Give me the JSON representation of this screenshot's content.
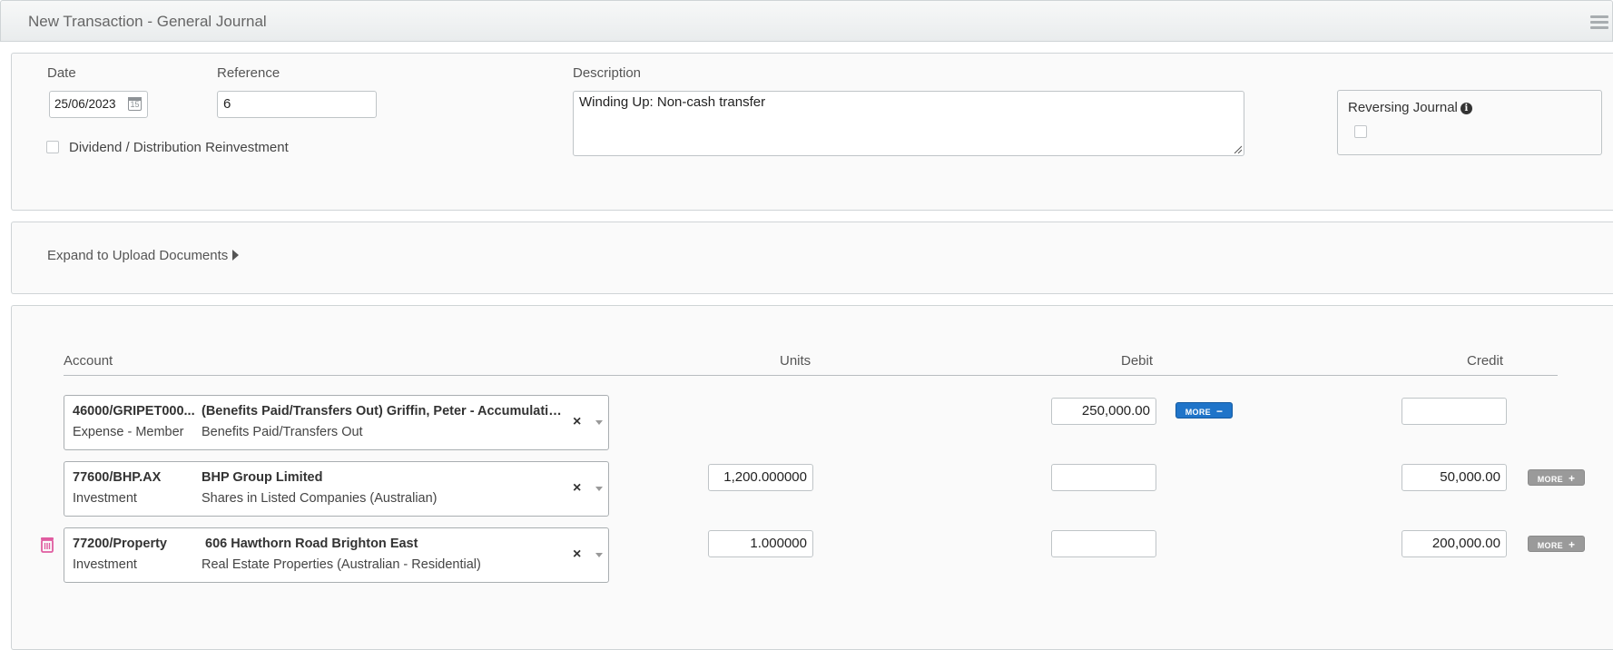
{
  "window": {
    "title": "New Transaction - General Journal"
  },
  "header_form": {
    "date_label": "Date",
    "date_value": "25/06/2023",
    "date_icon_text": "15",
    "reference_label": "Reference",
    "reference_value": "6",
    "description_label": "Description",
    "description_value": "Winding Up: Non-cash transfer",
    "dividend_label": "Dividend / Distribution Reinvestment",
    "dividend_checked": false,
    "reversing_label": "Reversing Journal",
    "reversing_checked": false
  },
  "upload": {
    "label": "Expand to Upload Documents"
  },
  "lines": {
    "columns": {
      "account": "Account",
      "units": "Units",
      "debit": "Debit",
      "credit": "Credit"
    },
    "rows": [
      {
        "code": "46000/GRIPET000...",
        "name": "(Benefits Paid/Transfers Out) Griffin, Peter - Accumulation ...",
        "type": "Expense - Member",
        "category": "Benefits Paid/Transfers Out",
        "units": "",
        "debit": "250,000.00",
        "credit": "",
        "more_label": "MORE",
        "more_symbol": "−"
      },
      {
        "code": "77600/BHP.AX",
        "name": "BHP Group Limited",
        "type": "Investment",
        "category": "Shares in Listed Companies (Australian)",
        "units": "1,200.000000",
        "debit": "",
        "credit": "50,000.00",
        "more_label": "MORE",
        "more_symbol": "+"
      },
      {
        "code": "77200/Property",
        "name": "606 Hawthorn Road Brighton East",
        "type": "Investment",
        "category": "Real Estate Properties (Australian - Residential)",
        "units": "1.000000",
        "debit": "",
        "credit": "200,000.00",
        "more_label": "MORE",
        "more_symbol": "+"
      }
    ],
    "clear_symbol": "×"
  },
  "colors": {
    "more_active": "#1f74c9",
    "more_inactive": "#9a9a9a",
    "trash_icon": "#e05ca0"
  }
}
